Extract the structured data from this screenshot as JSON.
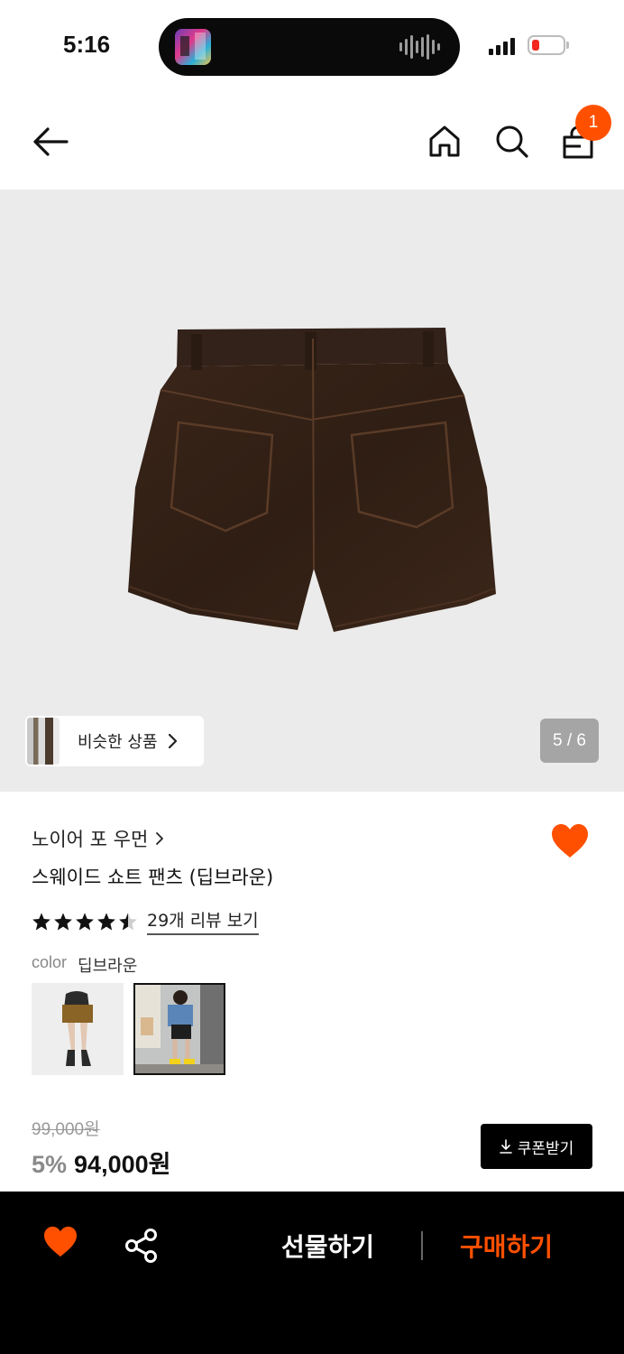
{
  "status_bar": {
    "time": "5:16"
  },
  "header": {
    "back_icon": "arrow-left-icon",
    "home_icon": "home-icon",
    "search_icon": "search-icon",
    "cart_icon": "shopping-bag-icon",
    "cart_count": "1"
  },
  "gallery": {
    "similar_products_label": "비슷한 상품",
    "page_counter": "5 / 6"
  },
  "product": {
    "brand": "노이어 포 우먼",
    "name": "스웨이드 쇼트 팬츠 (딥브라운)",
    "rating": 4.5,
    "review_link": "29개 리뷰 보기",
    "color_label": "color",
    "color_value": "딥브라운",
    "original_price": "99,000원",
    "discount": "5%",
    "final_price": "94,000원",
    "coupon_label": "쿠폰받기"
  },
  "bottom_bar": {
    "gift_label": "선물하기",
    "buy_label": "구매하기"
  },
  "colors": {
    "accent": "#ff5000",
    "bottom_bar_bg": "#000000",
    "image_bg": "#ebebeb"
  }
}
